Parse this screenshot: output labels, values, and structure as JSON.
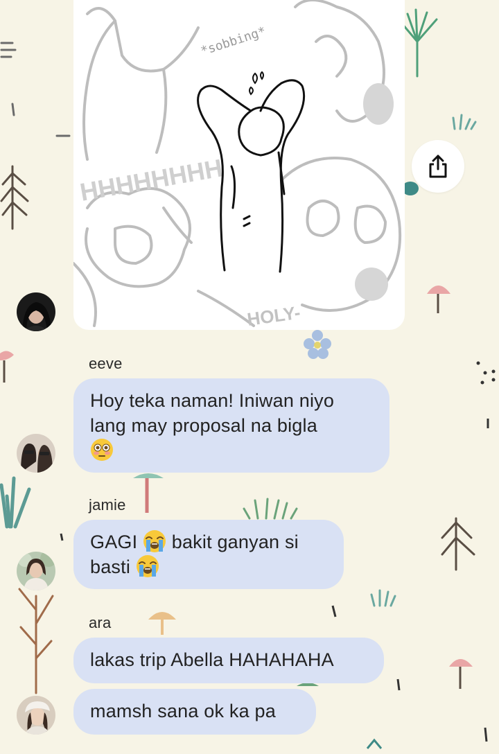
{
  "chat": {
    "sticker": {
      "sobbing_text": "*sobbing*",
      "scream_text": "HHHHHHHH",
      "holy_text": "HOLY-"
    },
    "share_button_label": "Share",
    "messages": [
      {
        "sender": "eeve",
        "text_1": "Hoy teka naman! Iniwan niyo",
        "text_2": "lang may proposal na bigla",
        "emoji": "flushed-face"
      },
      {
        "sender": "jamie",
        "text_1a": "GAGI",
        "text_1b": "bakit ganyan si",
        "text_2": "basti",
        "emoji": "loudly-crying-face"
      },
      {
        "sender": "ara",
        "text": "lakas trip Abella HAHAHAHA"
      },
      {
        "text": "mamsh sana ok ka pa"
      }
    ]
  },
  "colors": {
    "background": "#f7f4e6",
    "bubble": "#d9e1f4",
    "text": "#222222",
    "accent_icon": "#111111"
  }
}
